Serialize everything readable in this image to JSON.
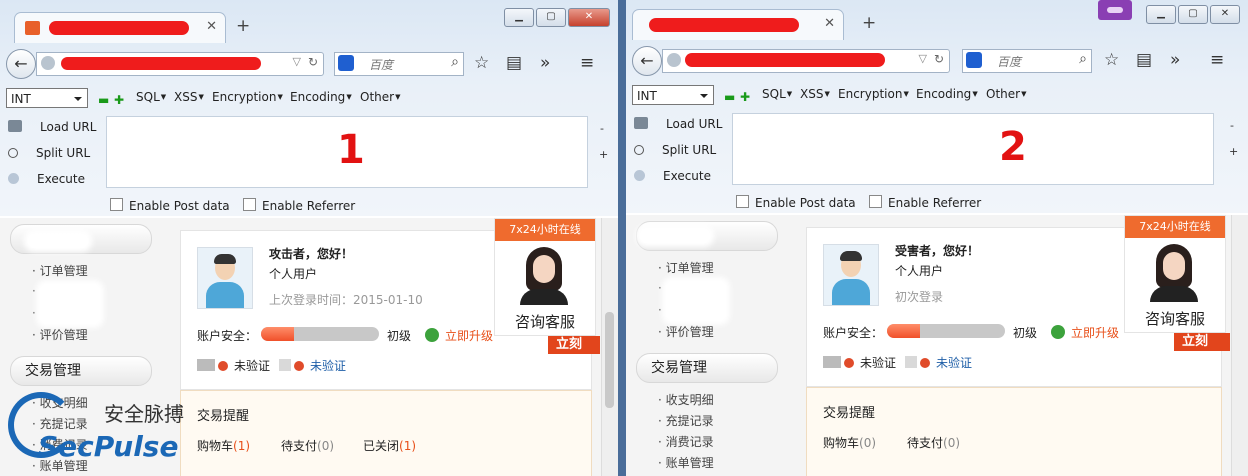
{
  "toolbar": {
    "select_value": "INT",
    "menus": [
      "SQL",
      "XSS",
      "Encryption",
      "Encoding",
      "Other"
    ],
    "load_url": "Load URL",
    "split_url": "Split URL",
    "execute": "Execute",
    "enable_post": "Enable Post data",
    "enable_referrer": "Enable Referrer",
    "minus": "-",
    "plus": "+"
  },
  "search_placeholder": "百度",
  "windows": [
    {
      "label_mark": "1",
      "greeting": "攻击者，您好！",
      "user_type": "个人用户",
      "last_login": "上次登录时间：2015-01-10",
      "security_level": 0.28
    },
    {
      "label_mark": "2",
      "greeting": "受害者，您好！",
      "user_type": "个人用户",
      "last_login": "初次登录",
      "security_level": 0.28
    }
  ],
  "account": {
    "security_label": "账户安全：",
    "level": "初级",
    "upgrade": "立即升级",
    "unverified_a": "未验证",
    "unverified_b": "未验证"
  },
  "sidebar": {
    "order_mgmt": "订单管理",
    "review_mgmt": "评价管理",
    "trade_header": "交易管理",
    "trade_items": [
      "收支明细",
      "充提记录",
      "消费记录",
      "账单管理"
    ]
  },
  "trade": {
    "title": "交易提醒",
    "cart": "购物车",
    "cart_count_1": "(1)",
    "cart_count_2": "(0)",
    "pending": "待支付",
    "pending_count": "(0)",
    "closed": "已关闭",
    "closed_count": "(1)"
  },
  "service": {
    "hours": "7x24小时在线",
    "label": "咨询客服",
    "button": "立刻"
  },
  "watermark": {
    "cn": "安全脉搏",
    "en": "SecPulse"
  },
  "colors": {
    "accent": "#ef6b2e",
    "upgrade": "#e8501a",
    "link": "#1f5fa8"
  }
}
